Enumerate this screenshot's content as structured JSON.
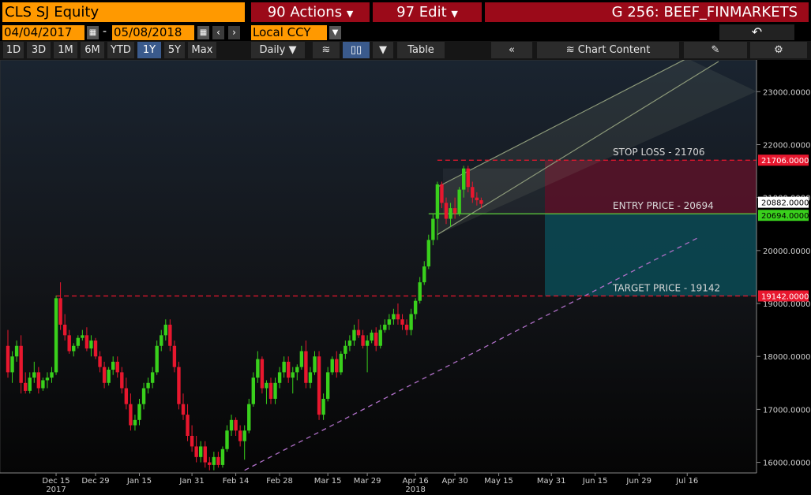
{
  "header": {
    "ticker": "CLS SJ Equity",
    "actions_label": "90 Actions",
    "edit_label": "97 Edit",
    "title": "G 256: BEEF_FINMARKETS",
    "back_icon": "back-arrow-icon"
  },
  "dates": {
    "start": "04/04/2017",
    "separator": "-",
    "end": "05/08/2018",
    "currency": "Local CCY"
  },
  "toolbar": {
    "ranges": [
      "1D",
      "3D",
      "1M",
      "6M",
      "YTD",
      "1Y",
      "5Y",
      "Max"
    ],
    "active_range": "1Y",
    "frequency": "Daily",
    "table_label": "Table",
    "collapse_label": "«",
    "chart_content_label": "Chart Content"
  },
  "colors": {
    "up": "#39d01c",
    "down": "#e8172e",
    "stop_zone": "#5b1329",
    "target_zone": "#0b4a55",
    "channel": "#8d9a7a",
    "accent": "#ff9900"
  },
  "chart_data": {
    "type": "candlestick",
    "ylim": [
      15800,
      23600
    ],
    "y_ticks": [
      "23000.0000",
      "22000.0000",
      "21000.0000",
      "20000.0000",
      "19000.0000",
      "18000.0000",
      "17000.0000",
      "16000.0000"
    ],
    "x_ticks": [
      {
        "label": "Dec 15",
        "sub": "2017",
        "idx": 11
      },
      {
        "label": "Dec 29",
        "sub": "",
        "idx": 20
      },
      {
        "label": "Jan 15",
        "sub": "",
        "idx": 30
      },
      {
        "label": "Jan 31",
        "sub": "",
        "idx": 42
      },
      {
        "label": "Feb 14",
        "sub": "",
        "idx": 52
      },
      {
        "label": "Feb 28",
        "sub": "",
        "idx": 62
      },
      {
        "label": "Mar 15",
        "sub": "",
        "idx": 73
      },
      {
        "label": "Mar 29",
        "sub": "",
        "idx": 82
      },
      {
        "label": "Apr 16",
        "sub": "2018",
        "idx": 93
      },
      {
        "label": "Apr 30",
        "sub": "",
        "idx": 102
      },
      {
        "label": "May 15",
        "sub": "",
        "idx": 112
      },
      {
        "label": "May 31",
        "sub": "",
        "idx": 124
      },
      {
        "label": "Jun 15",
        "sub": "",
        "idx": 134
      },
      {
        "label": "Jun 29",
        "sub": "",
        "idx": 144
      },
      {
        "label": "Jul 16",
        "sub": "",
        "idx": 155
      }
    ],
    "candles": [
      [
        18200,
        18500,
        17600,
        17700
      ],
      [
        17700,
        18100,
        17500,
        18000
      ],
      [
        18000,
        18300,
        17900,
        18200
      ],
      [
        18200,
        18400,
        17300,
        17500
      ],
      [
        17500,
        17700,
        17300,
        17350
      ],
      [
        17350,
        17700,
        17300,
        17600
      ],
      [
        17600,
        17900,
        17500,
        17700
      ],
      [
        17700,
        17800,
        17300,
        17400
      ],
      [
        17400,
        17600,
        17350,
        17550
      ],
      [
        17550,
        17700,
        17400,
        17600
      ],
      [
        17600,
        17800,
        17500,
        17700
      ],
      [
        17700,
        19150,
        17650,
        19100
      ],
      [
        19100,
        19400,
        18500,
        18600
      ],
      [
        18600,
        18800,
        18300,
        18400
      ],
      [
        18400,
        18500,
        18050,
        18100
      ],
      [
        18100,
        18250,
        18000,
        18200
      ],
      [
        18200,
        18400,
        18150,
        18350
      ],
      [
        18350,
        18500,
        18300,
        18400
      ],
      [
        18400,
        18550,
        18100,
        18150
      ],
      [
        18150,
        18400,
        18000,
        18300
      ],
      [
        18300,
        18350,
        17950,
        18000
      ],
      [
        18000,
        18100,
        17700,
        17800
      ],
      [
        17800,
        17900,
        17400,
        17500
      ],
      [
        17500,
        17800,
        17450,
        17750
      ],
      [
        17750,
        18000,
        17650,
        17900
      ],
      [
        17900,
        18000,
        17600,
        17700
      ],
      [
        17700,
        17800,
        17300,
        17400
      ],
      [
        17400,
        17600,
        17000,
        17100
      ],
      [
        17100,
        17300,
        16600,
        16700
      ],
      [
        16700,
        16900,
        16600,
        16800
      ],
      [
        16800,
        17200,
        16700,
        17100
      ],
      [
        17100,
        17500,
        17000,
        17400
      ],
      [
        17400,
        17600,
        17300,
        17500
      ],
      [
        17500,
        17800,
        17400,
        17700
      ],
      [
        17700,
        18300,
        17650,
        18200
      ],
      [
        18200,
        18500,
        18100,
        18400
      ],
      [
        18400,
        18700,
        18300,
        18600
      ],
      [
        18600,
        18700,
        18100,
        18200
      ],
      [
        18200,
        18300,
        17700,
        17800
      ],
      [
        17800,
        17900,
        17000,
        17100
      ],
      [
        17100,
        17300,
        16800,
        16900
      ],
      [
        16900,
        17100,
        16400,
        16500
      ],
      [
        16500,
        16700,
        16200,
        16300
      ],
      [
        16300,
        16500,
        16000,
        16100
      ],
      [
        16100,
        16400,
        16000,
        16300
      ],
      [
        16300,
        16400,
        15900,
        16000
      ],
      [
        16000,
        16100,
        15850,
        15950
      ],
      [
        15950,
        16200,
        15850,
        16100
      ],
      [
        16100,
        16200,
        15900,
        15950
      ],
      [
        15950,
        16300,
        15900,
        16250
      ],
      [
        16250,
        16700,
        16200,
        16600
      ],
      [
        16600,
        16900,
        16500,
        16800
      ],
      [
        16800,
        16850,
        16500,
        16600
      ],
      [
        16600,
        16700,
        16300,
        16400
      ],
      [
        16400,
        16700,
        16050,
        16600
      ],
      [
        16600,
        17200,
        16550,
        17100
      ],
      [
        17100,
        17700,
        17050,
        17600
      ],
      [
        17600,
        18100,
        17500,
        17950
      ],
      [
        17950,
        18000,
        17300,
        17400
      ],
      [
        17400,
        17550,
        17100,
        17500
      ],
      [
        17500,
        17600,
        17100,
        17200
      ],
      [
        17200,
        17600,
        17100,
        17500
      ],
      [
        17500,
        17800,
        17400,
        17700
      ],
      [
        17700,
        18000,
        17600,
        17900
      ],
      [
        17900,
        18000,
        17500,
        17600
      ],
      [
        17600,
        17800,
        17300,
        17700
      ],
      [
        17700,
        17850,
        17550,
        17800
      ],
      [
        17800,
        18200,
        17750,
        18100
      ],
      [
        18100,
        18300,
        17400,
        17500
      ],
      [
        17500,
        17800,
        17400,
        17700
      ],
      [
        17700,
        18100,
        17650,
        18000
      ],
      [
        18000,
        18100,
        16800,
        16900
      ],
      [
        16900,
        17300,
        16800,
        17200
      ],
      [
        17200,
        17800,
        17150,
        17700
      ],
      [
        17700,
        18000,
        17650,
        17950
      ],
      [
        17950,
        18100,
        17600,
        17700
      ],
      [
        17700,
        18100,
        17650,
        18050
      ],
      [
        18050,
        18300,
        17950,
        18200
      ],
      [
        18200,
        18400,
        18100,
        18300
      ],
      [
        18300,
        18600,
        18200,
        18500
      ],
      [
        18500,
        18700,
        18350,
        18400
      ],
      [
        18400,
        18500,
        18150,
        18200
      ],
      [
        18200,
        18400,
        17700,
        18300
      ],
      [
        18300,
        18500,
        18250,
        18450
      ],
      [
        18450,
        18550,
        18100,
        18200
      ],
      [
        18200,
        18600,
        18150,
        18500
      ],
      [
        18500,
        18700,
        18450,
        18600
      ],
      [
        18600,
        18800,
        18500,
        18700
      ],
      [
        18700,
        18900,
        18600,
        18800
      ],
      [
        18800,
        19000,
        18600,
        18700
      ],
      [
        18700,
        18800,
        18500,
        18600
      ],
      [
        18600,
        18700,
        18400,
        18500
      ],
      [
        18500,
        18900,
        18400,
        18800
      ],
      [
        18800,
        19100,
        18700,
        19050
      ],
      [
        19050,
        19500,
        19000,
        19400
      ],
      [
        19400,
        19800,
        19350,
        19700
      ],
      [
        19700,
        20300,
        19650,
        20200
      ],
      [
        20200,
        20700,
        20100,
        20600
      ],
      [
        20600,
        21300,
        20200,
        21250
      ],
      [
        21250,
        21300,
        20800,
        20900
      ],
      [
        20900,
        21000,
        20500,
        20600
      ],
      [
        20600,
        20900,
        20450,
        20800
      ],
      [
        20800,
        21000,
        20600,
        20700
      ],
      [
        20700,
        21200,
        20650,
        21150
      ],
      [
        21150,
        21600,
        21000,
        21550
      ],
      [
        21550,
        21600,
        21100,
        21200
      ],
      [
        21200,
        21300,
        20900,
        21000
      ],
      [
        21000,
        21100,
        20850,
        20950
      ],
      [
        20950,
        21000,
        20800,
        20882
      ]
    ],
    "levels": [
      {
        "name": "STOP LOSS - 21706",
        "value": 21706,
        "tag": "21706.0000"
      },
      {
        "name": "ENTRY PRICE - 20694",
        "value": 20694,
        "tag": "20694.0000"
      },
      {
        "name": "TARGET PRICE - 19142",
        "value": 19142,
        "tag": "19142.0000"
      }
    ],
    "last_price_tag": "20882.0000",
    "last_price": 20882,
    "grid": "off"
  }
}
